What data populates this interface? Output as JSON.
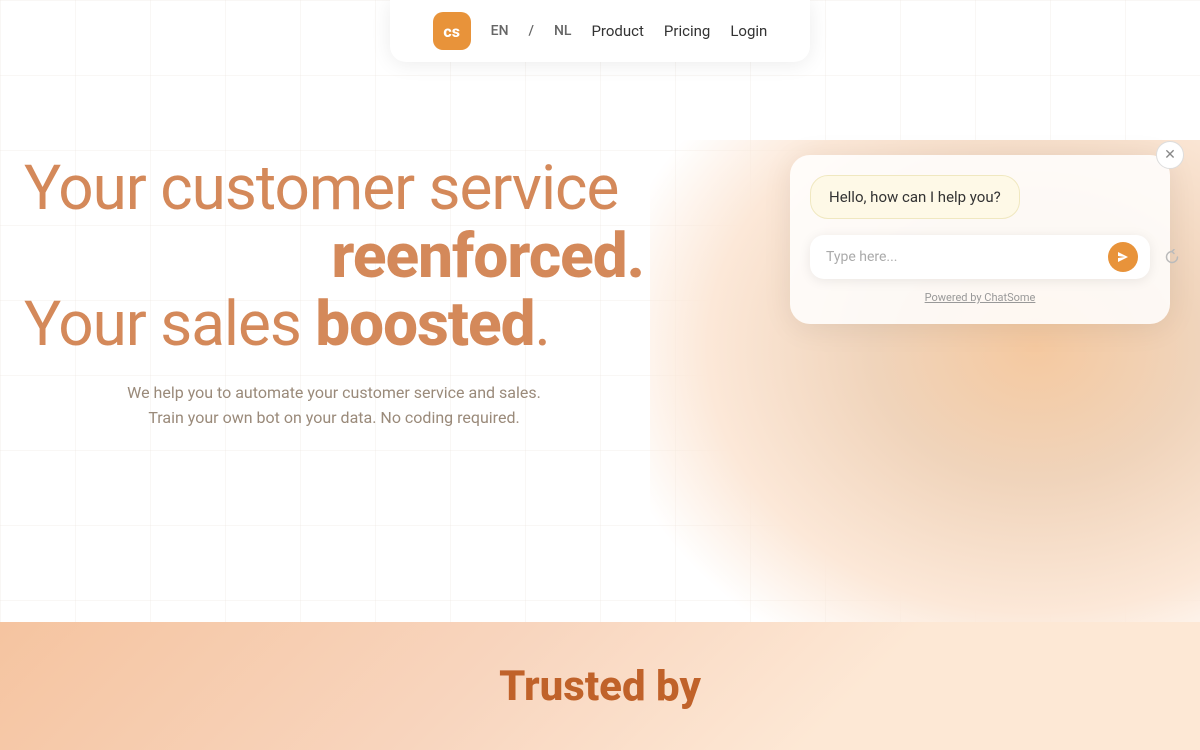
{
  "navbar": {
    "logo_text": "cs",
    "lang_en": "EN",
    "lang_nl": "NL",
    "lang_separator": "/",
    "product_label": "Product",
    "pricing_label": "Pricing",
    "login_label": "Login"
  },
  "hero": {
    "line1": "Your customer service",
    "line2": "reenforced.",
    "line3_normal": "Your sales ",
    "line3_bold": "boosted",
    "line3_end": ".",
    "subtitle_line1": "We help you to automate your customer service and sales.",
    "subtitle_line2": "Train your own bot on your data. No coding required."
  },
  "chat_widget": {
    "greeting": "Hello, how can I help you?",
    "input_placeholder": "Type here...",
    "powered_by": "Powered by ChatSome"
  },
  "bottom_section": {
    "trusted_label": "Trusted by"
  },
  "colors": {
    "orange_accent": "#e8933a",
    "text_orange": "#d4895a",
    "text_gray": "#9a8a7a"
  }
}
